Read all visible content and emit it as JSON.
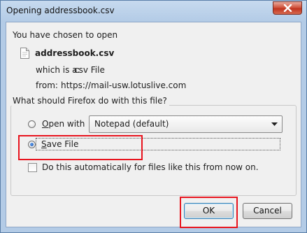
{
  "window": {
    "title": "Opening addressbook.csv"
  },
  "dialog": {
    "intro": "You have chosen to open",
    "file_name": "addressbook.csv",
    "type_label": "which is a:",
    "type_value": "csv File",
    "from_label": "from:",
    "from_value": "https://mail-usw.lotuslive.com",
    "group_title": "What should Firefox do with this file?",
    "open_with": {
      "label_prefix": "O",
      "label_rest": "pen with",
      "selected": false
    },
    "app_select": {
      "value": "Notepad (default)"
    },
    "save_file": {
      "label_prefix": "S",
      "label_rest": "ave File",
      "selected": true
    },
    "auto_checkbox": {
      "label": "Do this automatically for files like this from now on.",
      "checked": false
    },
    "ok_label": "OK",
    "cancel_label": "Cancel"
  },
  "annotations": {
    "highlight_color": "#e8141e"
  },
  "icons": [
    "close-icon",
    "file-icon",
    "chevron-down-icon"
  ]
}
